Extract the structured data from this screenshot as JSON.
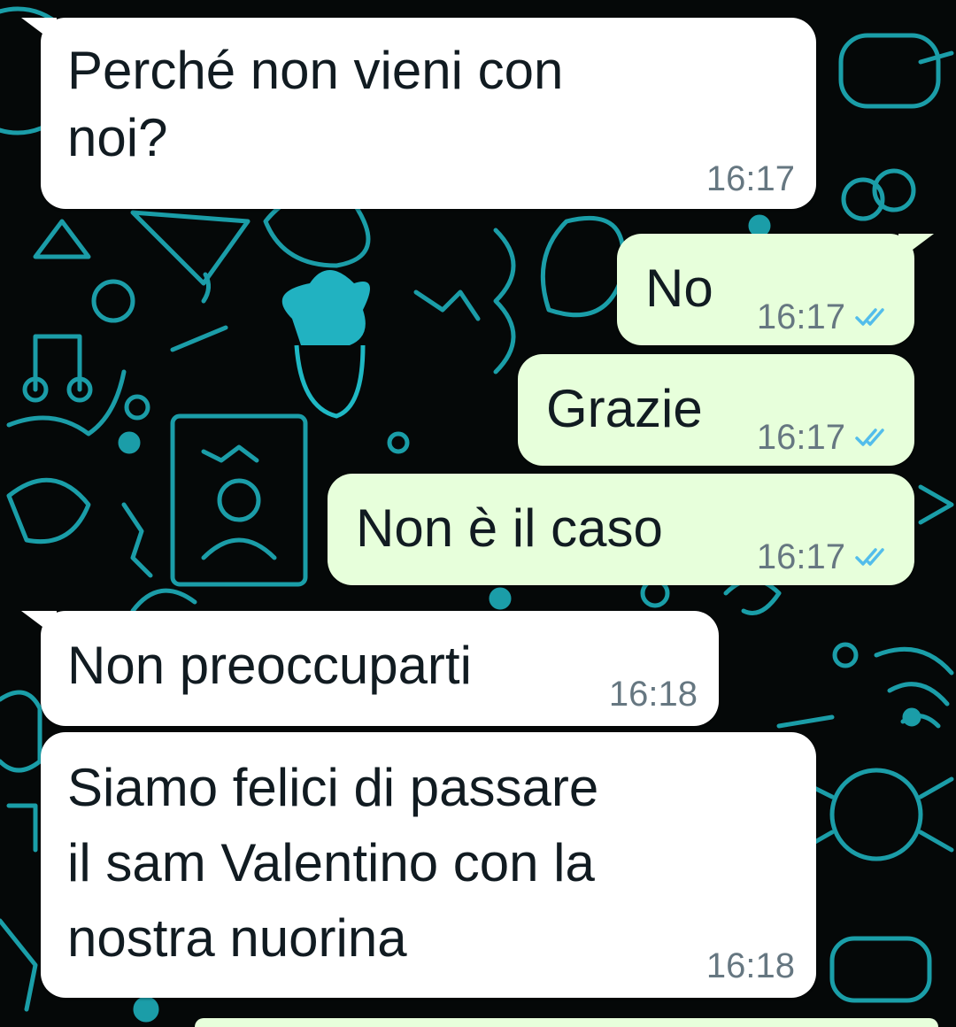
{
  "chat": {
    "messages": [
      {
        "direction": "incoming",
        "text_lines": [
          "Perché non vieni con",
          "noi?"
        ],
        "time": "16:17"
      },
      {
        "direction": "outgoing",
        "text_lines": [
          "No"
        ],
        "time": "16:17",
        "status": "read"
      },
      {
        "direction": "outgoing",
        "text_lines": [
          "Grazie"
        ],
        "time": "16:17",
        "status": "read"
      },
      {
        "direction": "outgoing",
        "text_lines": [
          "Non è il caso"
        ],
        "time": "16:17",
        "status": "read"
      },
      {
        "direction": "incoming",
        "text_lines": [
          "Non preoccuparti"
        ],
        "time": "16:18"
      },
      {
        "direction": "incoming",
        "text_lines": [
          "Siamo felici di passare",
          "il sam Valentino con la",
          "nostra nuorina"
        ],
        "time": "16:18"
      }
    ]
  },
  "colors": {
    "background": "#050808",
    "doodle": "#1fb8c4",
    "incoming_bubble": "#ffffff",
    "outgoing_bubble": "#e7ffdb",
    "read_ticks": "#53bdeb",
    "time_text": "#667781"
  },
  "icons": {
    "read_receipt": "double-check-icon"
  }
}
